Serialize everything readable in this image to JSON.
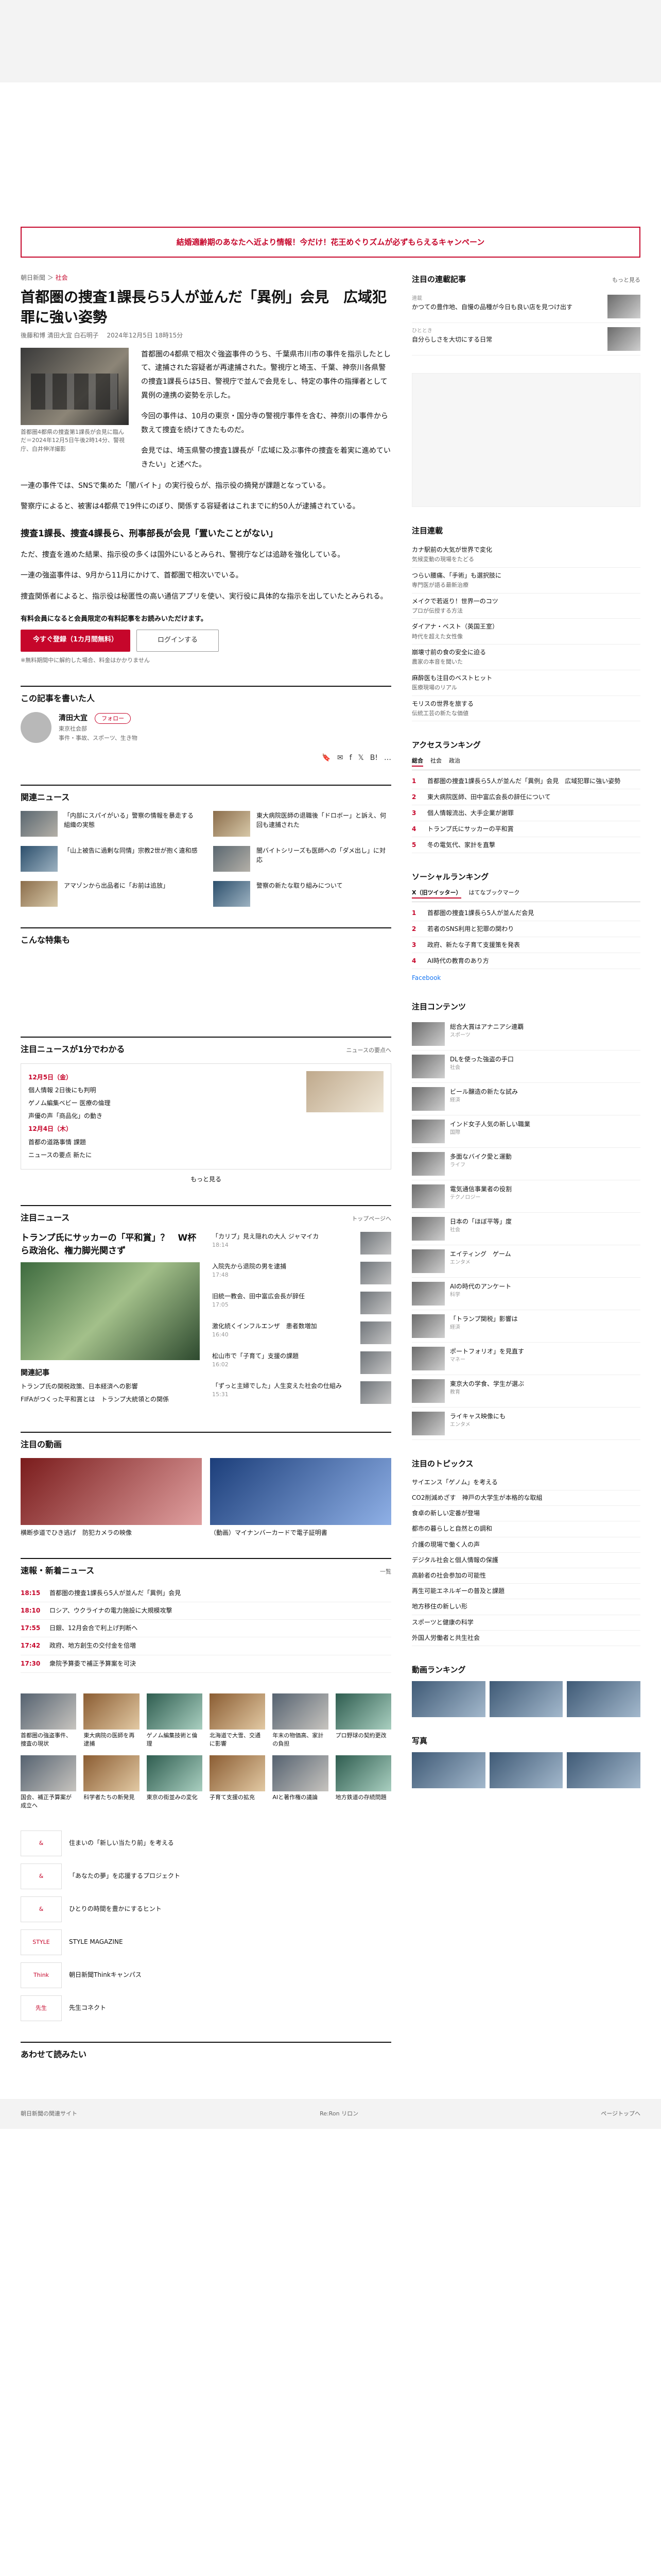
{
  "campaign": "結婚適齢期のあなたへ近より情報！今だけ！花王めぐりズムが必ずもらえるキャンペーン",
  "article": {
    "section": "朝日新聞",
    "category": "社会",
    "headline": "首都圏の捜査1課長ら5人が並んだ「異例」会見　広域犯罪に強い姿勢",
    "byline": "後藤和博 清田大宜 白石明子",
    "date": "2024年12月5日 18時15分",
    "photo_caption": "首都圏4都県の捜査第1課長が会見に臨んだ＝2024年12月5日午後2時14分、警視庁、白井伸洋撮影",
    "lead": "首都圏の4都県で相次ぐ強盗事件のうち、千葉県市川市の事件を指示したとして、逮捕された容疑者が再逮捕された。警視庁と埼玉、千葉、神奈川各県警の捜査1課長らは5日、警視庁で並んで会見をし、特定の事件の指揮者として異例の連携の姿勢を示した。",
    "paragraphs": [
      "今回の事件は、10月の東京・国分寺の警視庁事件を含む、神奈川の事件から数えて捜査を続けてきたものだ。",
      "会見では、埼玉県警の捜査1課長が「広域に及ぶ事件の捜査を着実に進めていきたい」と述べた。",
      "一連の事件では、SNSで集めた「闇バイト」の実行役らが、指示役の摘発が課題となっている。",
      "警察庁によると、被害は4都県で19件にのぼり、関係する容疑者はこれまでに約50人が逮捕されている。"
    ],
    "subhead": "捜査1課長、捜査4課長ら、刑事部長が会見「置いたことがない」",
    "paragraphs2": [
      "ただ、捜査を進めた結果、指示役の多くは国外にいるとみられ、警視庁などは追跡を強化している。",
      "一連の強盗事件は、9月から11月にかけて、首都圏で相次いでいる。",
      "捜査関係者によると、指示役は秘匿性の高い通信アプリを使い、実行役に具体的な指示を出していたとみられる。"
    ],
    "paywall_title": "有料会員になると会員限定の有料記事をお読みいただけます。",
    "subscribe_label": "今すぐ登録（1カ月間無料）",
    "login_label": "ログインする",
    "paywall_note": "※無料期間中に解約した場合、料金はかかりません"
  },
  "author_section": {
    "title": "この記事を書いた人",
    "name": "清田大宜",
    "affiliation": "東京社会部",
    "follow_label": "フォロー",
    "tags": "事件・事故、スポーツ、生き物"
  },
  "share": {
    "bookmark": "🔖",
    "mail": "✉",
    "facebook": "f",
    "x": "𝕏",
    "hatena": "B!",
    "more": "…"
  },
  "related": {
    "title": "関連ニュース",
    "items": [
      "「内部にスパイがいる」警察の情報を暴走する組織の実態",
      "東大病院医師の退職後「ドロボー」と訴え、何回も逮捕された",
      "「山上被告に過剰な同情」宗教2世が抱く違和感",
      "闇バイトシリーズも医師への「ダメ出し」に対応",
      "アマゾンから出品者に「お前は追放」",
      "警察の新たな取り組みについて"
    ]
  },
  "hot": {
    "title": "こんな特集も"
  },
  "topics": {
    "title": "注目ニュースが1分でわかる",
    "more": "ニュースの要点へ",
    "day1": "12月5日（金）",
    "items": [
      "個人情報 2日後にも判明",
      "ゲノム編集ベビー 医療の倫理",
      "声優の声「商品化」の動き"
    ],
    "day2": "12月4日（木）",
    "items2": [
      "首都の道路事情 課題",
      "ニュースの要点 新たに"
    ],
    "more_label": "もっと見る"
  },
  "news": {
    "title": "注目ニュース",
    "more": "トップページへ",
    "main_title": "トランプ氏にサッカーの「平和賞」？　W杯ら政治化、権力脚光関さず",
    "list": [
      {
        "t": "「カリブ」見え隠れの大人 ジャマイカ",
        "ts": "18:14"
      },
      {
        "t": "入院先から退院の男を逮捕",
        "ts": "17:48"
      },
      {
        "t": "旧統一教会、田中富広会長が辞任",
        "ts": "17:05"
      },
      {
        "t": "激化続くインフルエンザ　患者数増加",
        "ts": "16:40"
      },
      {
        "t": "松山市で「子育て」支援の課題",
        "ts": "16:02"
      },
      {
        "t": "「ずっと主婦でした」人生変えた社会の仕組み",
        "ts": "15:31"
      }
    ],
    "sub_title": "関連記事",
    "sub": [
      "トランプ氏の関税政策、日本経済への影響",
      "FIFAがつくった平和賞とは　トランプ大統領との関係"
    ]
  },
  "videos": {
    "title": "注目の動画",
    "items": [
      "横断歩道でひき逃げ　防犯カメラの映像",
      "（動画）マイナンバーカードで電子証明書"
    ]
  },
  "flash": {
    "title": "速報・新着ニュース",
    "more": "一覧",
    "items": [
      {
        "tm": "18:15",
        "tx": "首都圏の捜査1課長ら5人が並んだ「異例」会見"
      },
      {
        "tm": "18:10",
        "tx": "ロシア、ウクライナの電力施設に大規模攻撃"
      },
      {
        "tm": "17:55",
        "tx": "日銀、12月会合で利上げ判断へ"
      },
      {
        "tm": "17:42",
        "tx": "政府、地方創生の交付金を倍増"
      },
      {
        "tm": "17:30",
        "tx": "衆院予算委で補正予算案を可決"
      }
    ]
  },
  "tiles": [
    "首都圏の強盗事件、捜査の現状",
    "東大病院の医師を再逮捕",
    "ゲノム編集技術と倫理",
    "北海道で大雪、交通に影響",
    "年末の物価高、家計の負担",
    "プロ野球の契約更改",
    "国会、補正予算案が成立へ",
    "科学者たちの新発見",
    "東京の街並みの変化",
    "子育て支援の拡充",
    "AIと著作権の議論",
    "地方鉄道の存続問題"
  ],
  "brands": [
    {
      "logo": "&",
      "tx": "住まいの「新しい当たり前」を考える"
    },
    {
      "logo": "&",
      "tx": "「あなたの夢」を応援するプロジェクト"
    },
    {
      "logo": "&",
      "tx": "ひとりの時間を豊かにするヒント"
    },
    {
      "logo": "STYLE",
      "tx": "STYLE MAGAZINE"
    },
    {
      "logo": "Think",
      "tx": "朝日新聞Thinkキャンパス"
    },
    {
      "logo": "先生",
      "tx": "先生コネクト"
    }
  ],
  "next": "あわせて読みたい",
  "side": {
    "pickup_title": "注目の連載記事",
    "pickup_more": "もっと見る",
    "pickup": [
      {
        "lab": "連載",
        "t": "かつての豊作地、自慢の品種が今日も良い店を見つけ出す"
      },
      {
        "lab": "ひととき",
        "t": "自分らしさを大切にする日常"
      }
    ],
    "sponsor_title": "注目連載",
    "sponsor": [
      {
        "t": "カナ駅前の大気が世界で変化",
        "s": "気候変動の現場をたどる"
      },
      {
        "t": "つらい腰痛、「手術」も選択肢に",
        "s": "専門医が語る最新治療"
      },
      {
        "t": "メイクで若返り！世界一のコツ",
        "s": "プロが伝授する方法"
      },
      {
        "t": "ダイアナ・ベスト（英国王室）",
        "s": "時代を超えた女性像"
      },
      {
        "t": "崩壊寸前の食の安全に迫る",
        "s": "農家の本音を聞いた"
      },
      {
        "t": "麻酔医も注目のベストヒット",
        "s": "医療現場のリアル"
      },
      {
        "t": "モリスの世界を旅する",
        "s": "伝統工芸の新たな価値"
      }
    ],
    "access_title": "アクセスランキング",
    "access_tabs": [
      "総合",
      "社会",
      "政治"
    ],
    "access": [
      "首都圏の捜査1課長ら5人が並んだ「異例」会見　広域犯罪に強い姿勢",
      "東大病院医師、田中富広会長の辞任について",
      "個人情報流出、大手企業が謝罪",
      "トランプ氏にサッカーの平和賞",
      "冬の電気代、家計を直撃"
    ],
    "social_title": "ソーシャルランキング",
    "social_tabs": [
      "X（旧ツイッター）",
      "はてなブックマーク"
    ],
    "social": [
      "首都圏の捜査1課長ら5人が並んだ会見",
      "若者のSNS利用と犯罪の関わり",
      "政府、新たな子育て支援策を発表",
      "AI時代の教育のあり方"
    ],
    "facebook": "Facebook",
    "promo_title": "注目コンテンツ",
    "promo": [
      {
        "t": "総合大賞はアナニアシ連覇",
        "s": "スポーツ"
      },
      {
        "t": "DLを使った強盗の手口",
        "s": "社会"
      },
      {
        "t": "ビール醸造の新たな試み",
        "s": "経済"
      },
      {
        "t": "インド女子人気の新しい職業",
        "s": "国際"
      },
      {
        "t": "多面なバイク愛と運動",
        "s": "ライフ"
      },
      {
        "t": "電気通信事業者の役割",
        "s": "テクノロジー"
      },
      {
        "t": "日本の「ほぼ平等」度",
        "s": "社会"
      },
      {
        "t": "エイティング　ゲーム",
        "s": "エンタメ"
      },
      {
        "t": "AIの時代のアンケート",
        "s": "科学"
      },
      {
        "t": "「トランプ関税」影響は",
        "s": "経済"
      },
      {
        "t": "ポートフォリオ」を見直す",
        "s": "マネー"
      },
      {
        "t": "東京大の学食、学生が選ぶ",
        "s": "教育"
      },
      {
        "t": "ライキャス映像にも",
        "s": "エンタメ"
      }
    ],
    "topics_title": "注目のトピックス",
    "topics": [
      "サイエンス「ゲノム」を考える",
      "CO2削減めざす　神戸の大学生が本格的な取組",
      "食卓の新しい定番が登場",
      "都市の暮らしと自然との調和",
      "介護の現場で働く人の声",
      "デジタル社会と個人情報の保護",
      "高齢者の社会参加の可能性",
      "再生可能エネルギーの普及と課題",
      "地方移住の新しい形",
      "スポーツと健康の科学",
      "外国人労働者と共生社会"
    ],
    "video_title": "動画ランキング",
    "photo_title": "写真"
  },
  "footer": {
    "left": "朝日新聞の関連サイト",
    "logo": "Re:Ron リロン",
    "right": "ページトップへ"
  }
}
